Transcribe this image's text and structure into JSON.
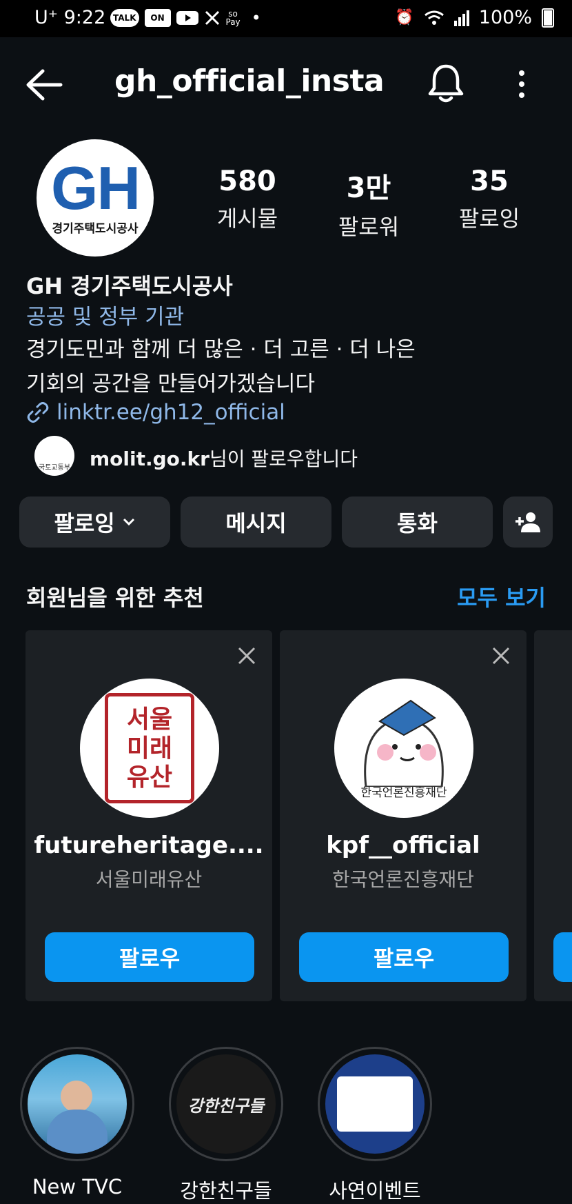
{
  "status_bar": {
    "carrier": "U⁺",
    "time": "9:22",
    "notif_icons": [
      "TALK",
      "ON"
    ],
    "pay_label": "Pay",
    "battery": "100%"
  },
  "header": {
    "title": "gh_official_insta",
    "back_icon": "arrow-left-icon",
    "bell_icon": "bell-icon",
    "more_icon": "more-vertical-icon"
  },
  "profile": {
    "logo_text": "GH",
    "logo_subtext": "경기주택도시공사",
    "stats": [
      {
        "value": "580",
        "label": "게시물"
      },
      {
        "value": "3만",
        "label": "팔로워"
      },
      {
        "value": "35",
        "label": "팔로잉"
      }
    ],
    "name": "GH 경기주택도시공사",
    "category": "공공 및 정부 기관",
    "bio_line1": "경기도민과 함께 더 많은 · 더 고른 · 더 나은",
    "bio_line2": "기회의 공간을 만들어가겠습니다",
    "link": "linktr.ee/gh12_official",
    "followed_by_user": "molit.go.kr",
    "followed_by_suffix": "님이 팔로우합니다",
    "followed_by_avatar_text": "국토교통부"
  },
  "actions": {
    "following": "팔로잉",
    "message": "메시지",
    "call": "통화"
  },
  "suggestions": {
    "title": "회원님을 위한 추천",
    "see_all": "모두 보기",
    "cards": [
      {
        "username": "futureheritage....",
        "name": "서울미래유산",
        "button": "팔로우",
        "seal": [
          "서울",
          "미래",
          "유산"
        ]
      },
      {
        "username": "kpf__official",
        "name": "한국언론진흥재단",
        "button": "팔로우",
        "avatar_caption": "한국언론진흥재단"
      }
    ]
  },
  "highlights": [
    {
      "label": "New TVC"
    },
    {
      "label": "강한친구들",
      "cover_text": "강한친구들"
    },
    {
      "label": "사연이벤트"
    }
  ],
  "colors": {
    "background": "#0c1014",
    "accent_blue": "#0a95f0",
    "link_blue": "#8fb8e8",
    "button_gray": "#262a2f",
    "gh_blue": "#1f5fb0"
  }
}
